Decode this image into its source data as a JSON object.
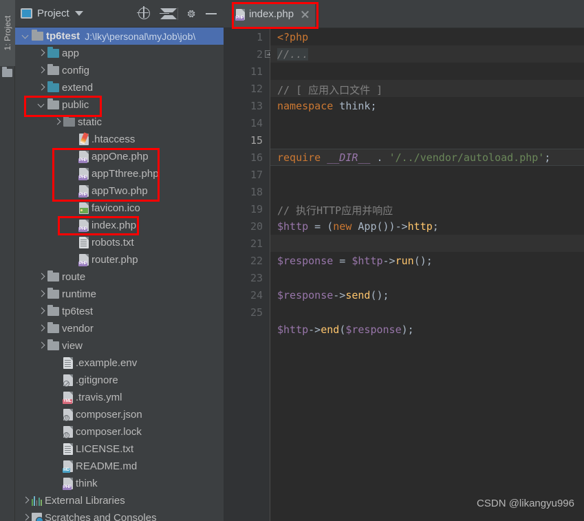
{
  "window": {
    "left_tool_tab": "1: Project",
    "watermark": "CSDN @likangyu996"
  },
  "panel": {
    "title": "Project",
    "icons": {
      "project": "project-icon",
      "dropdown": "chevron-down-icon",
      "locate": "locate-target-icon",
      "collapse_all": "collapse-all-icon",
      "settings": "gear-icon",
      "minimize": "minimize-icon"
    }
  },
  "tree": [
    {
      "label": "tp6test",
      "path": "J:\\lky\\personal\\myJob\\job\\",
      "type": "folder",
      "icon": "folder-icon",
      "state": "open",
      "indent": 0,
      "selected": true,
      "bold": true
    },
    {
      "label": "app",
      "type": "folder",
      "icon": "folder-teal-icon",
      "state": "closed",
      "indent": 1
    },
    {
      "label": "config",
      "type": "folder",
      "icon": "folder-icon",
      "state": "closed",
      "indent": 1
    },
    {
      "label": "extend",
      "type": "folder",
      "icon": "folder-teal-icon",
      "state": "closed",
      "indent": 1
    },
    {
      "label": "public",
      "type": "folder",
      "icon": "folder-icon",
      "state": "open",
      "indent": 1,
      "highlight": true
    },
    {
      "label": "static",
      "type": "folder",
      "icon": "folder-dim-icon",
      "state": "closed",
      "indent": 2
    },
    {
      "label": ".htaccess",
      "type": "file",
      "icon": "file-htaccess-icon",
      "indent": 3
    },
    {
      "label": "appOne.php",
      "type": "file",
      "icon": "file-php-icon",
      "badge": "PHP",
      "indent": 3,
      "highlight": true
    },
    {
      "label": "appTthree.php",
      "type": "file",
      "icon": "file-php-icon",
      "badge": "PHP",
      "indent": 3,
      "highlight": true
    },
    {
      "label": "appTwo.php",
      "type": "file",
      "icon": "file-php-icon",
      "badge": "PHP",
      "indent": 3,
      "highlight": true
    },
    {
      "label": "favicon.ico",
      "type": "file",
      "icon": "file-image-icon",
      "indent": 3
    },
    {
      "label": "index.php",
      "type": "file",
      "icon": "file-php-icon",
      "badge": "PHP",
      "indent": 3,
      "highlight": true
    },
    {
      "label": "robots.txt",
      "type": "file",
      "icon": "file-text-icon",
      "indent": 3
    },
    {
      "label": "router.php",
      "type": "file",
      "icon": "file-php-icon",
      "badge": "PHP",
      "indent": 3
    },
    {
      "label": "route",
      "type": "folder",
      "icon": "folder-icon",
      "state": "closed",
      "indent": 1
    },
    {
      "label": "runtime",
      "type": "folder",
      "icon": "folder-icon",
      "state": "closed",
      "indent": 1
    },
    {
      "label": "tp6test",
      "type": "folder",
      "icon": "folder-icon",
      "state": "closed",
      "indent": 1
    },
    {
      "label": "vendor",
      "type": "folder",
      "icon": "folder-icon",
      "state": "closed",
      "indent": 1
    },
    {
      "label": "view",
      "type": "folder",
      "icon": "folder-icon",
      "state": "closed",
      "indent": 1
    },
    {
      "label": ".example.env",
      "type": "file",
      "icon": "file-text-icon",
      "indent": 2
    },
    {
      "label": ".gitignore",
      "type": "file",
      "icon": "file-gitignore-icon",
      "indent": 2
    },
    {
      "label": ".travis.yml",
      "type": "file",
      "icon": "file-yml-icon",
      "badge": "YML",
      "indent": 2
    },
    {
      "label": "composer.json",
      "type": "file",
      "icon": "file-json-icon",
      "indent": 2
    },
    {
      "label": "composer.lock",
      "type": "file",
      "icon": "file-json-icon",
      "indent": 2
    },
    {
      "label": "LICENSE.txt",
      "type": "file",
      "icon": "file-text-icon",
      "indent": 2
    },
    {
      "label": "README.md",
      "type": "file",
      "icon": "file-md-icon",
      "badge": "MD",
      "indent": 2
    },
    {
      "label": "think",
      "type": "file",
      "icon": "file-php-icon",
      "badge": "PHP",
      "indent": 2
    },
    {
      "label": "External Libraries",
      "type": "node",
      "icon": "external-libraries-icon",
      "state": "closed",
      "indent": 0
    },
    {
      "label": "Scratches and Consoles",
      "type": "node",
      "icon": "scratches-icon",
      "state": "closed",
      "indent": 0
    }
  ],
  "editor": {
    "tab": {
      "label": "index.php",
      "icon": "file-php-icon",
      "badge": "PHP",
      "close": "close-icon",
      "highlight": true
    },
    "line_numbers": [
      "1",
      "2",
      "11",
      "12",
      "13",
      "14",
      "15",
      "16",
      "17",
      "18",
      "19",
      "20",
      "21",
      "22",
      "23",
      "24",
      "25"
    ],
    "current_line": "15",
    "fold_marker_line": "2",
    "lines": {
      "l1": "<?php",
      "l2": "//...",
      "l12": "// [ 应用入口文件 ]",
      "l13_kw": "namespace",
      "l13_name": " think",
      "l13_end": ";",
      "l15_kw": "require",
      "l15_const": " __DIR__",
      "l15_dot": " . ",
      "l15_str": "'/../vendor/autoload.php'",
      "l15_end": ";",
      "l17": "// 执行HTTP应用并响应",
      "l18_var": "$http",
      "l18_eq": " = (",
      "l18_new": "new",
      "l18_cls": " App())->",
      "l18_prop": "http",
      "l18_end": ";",
      "l20_var": "$response",
      "l20_eq": " = ",
      "l20_var2": "$http",
      "l20_arrow": "->",
      "l20_fn": "run",
      "l20_end": "();",
      "l22_var": "$response",
      "l22_arrow": "->",
      "l22_fn": "send",
      "l22_end": "();",
      "l24_var": "$http",
      "l24_arrow": "->",
      "l24_fn": "end",
      "l24_open": "(",
      "l24_arg": "$response",
      "l24_end": ");"
    }
  },
  "colors": {
    "panel_bg": "#3c3f41",
    "editor_bg": "#2b2b2b",
    "gutter_bg": "#313335",
    "selection": "#4b6eaf",
    "annotation": "#ff0000",
    "keyword": "#cc7832",
    "string": "#6a8759",
    "comment": "#808080",
    "variable": "#9876aa",
    "function": "#ffc66d"
  }
}
